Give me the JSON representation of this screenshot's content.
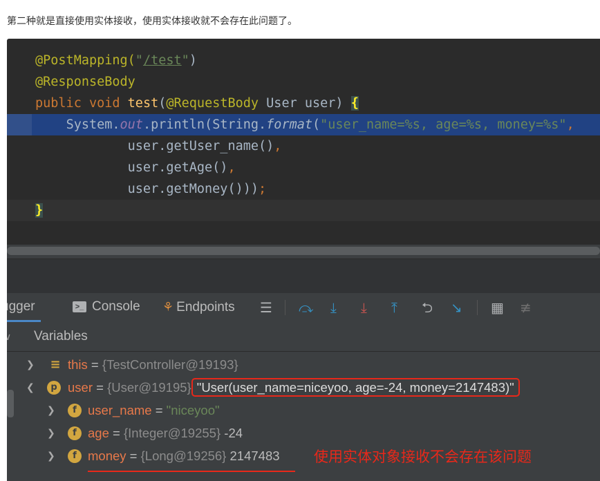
{
  "intro_text": "第二种就是直接使用实体接收，使用实体接收就不会存在此问题了。",
  "code": {
    "line1": {
      "annotation": "@PostMapping(",
      "quote_open": "\"",
      "path": "/test",
      "quote_close": "\"",
      "close": ")"
    },
    "line2": {
      "annotation": "@ResponseBody"
    },
    "line3": {
      "kw1": "public",
      "kw2": "void",
      "method": "test",
      "paren": "(",
      "param_ann": "@RequestBody",
      "param": " User user) ",
      "brace": "{"
    },
    "line4": {
      "pre": "System.",
      "out": "out",
      "mid": ".println(String.",
      "format": "format",
      "paren": "(",
      "str": "\"user_name=%s, age=%s, money=%s\"",
      "comma": ","
    },
    "line5": {
      "text": "user.getUser_name()",
      "comma": ","
    },
    "line6": {
      "text": "user.getAge()",
      "comma": ","
    },
    "line7": {
      "text": "user.getMoney()))",
      "semi": ";"
    },
    "line8": {
      "brace": "}"
    }
  },
  "toolbar": {
    "debugger_label": "ugger",
    "console_label": "Console",
    "endpoints_label": "Endpoints"
  },
  "variables": {
    "header": "Variables",
    "rows": [
      {
        "name": "this",
        "eq": " = ",
        "type": "{TestController@19193}",
        "value": ""
      },
      {
        "name": "user",
        "eq": " = ",
        "type": "{User@19195}",
        "value": "\"User(user_name=niceyoo, age=-24, money=2147483)\""
      },
      {
        "name": "user_name",
        "eq": " = ",
        "type": "",
        "value": "\"niceyoo\""
      },
      {
        "name": "age",
        "eq": " = ",
        "type": "{Integer@19255}",
        "value": " -24"
      },
      {
        "name": "money",
        "eq": " = ",
        "type": "{Long@19256}",
        "value": " 2147483"
      }
    ]
  },
  "annotation_text": "使用实体对象接收不会存在该问题",
  "colors": {
    "highlight": "#214283",
    "keyword": "#cc7832",
    "annotation": "#bbb529",
    "string": "#6a8759",
    "red_mark": "#e8281a"
  }
}
